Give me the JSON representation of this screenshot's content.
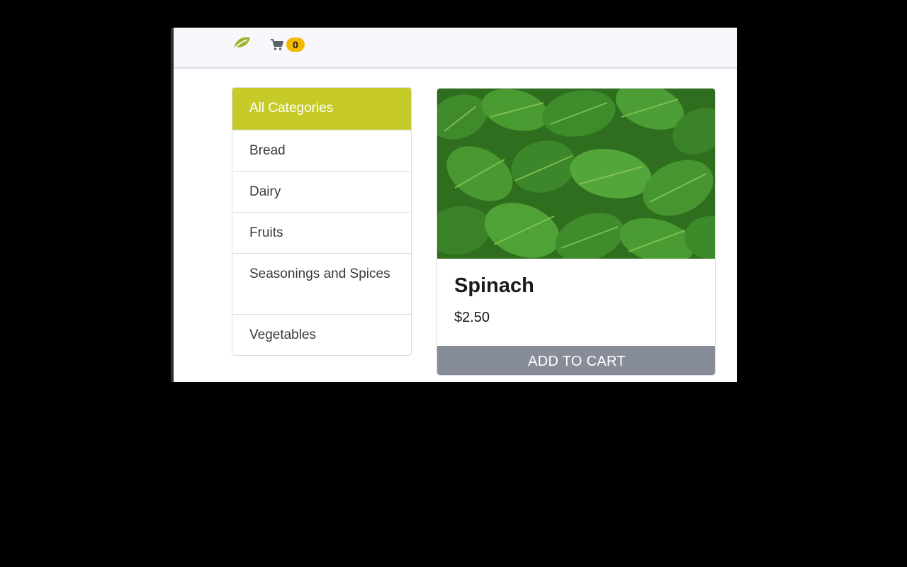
{
  "navbar": {
    "brand_icon": "leaf-icon",
    "cart_icon": "shopping-cart-icon",
    "cart_count": "0",
    "brand_color": "#9bb52a",
    "badge_color": "#f5b800"
  },
  "sidebar": {
    "active_color": "#c6cb2a",
    "items": [
      {
        "label": "All Categories",
        "active": true
      },
      {
        "label": "Bread"
      },
      {
        "label": "Dairy"
      },
      {
        "label": "Fruits"
      },
      {
        "label": "Seasonings and Spices"
      },
      {
        "label": "Vegetables"
      }
    ]
  },
  "product": {
    "image": "spinach-leaves-photo",
    "name": "Spinach",
    "price": "$2.50",
    "add_to_cart_label": "ADD TO CART",
    "button_color": "#878d98"
  }
}
